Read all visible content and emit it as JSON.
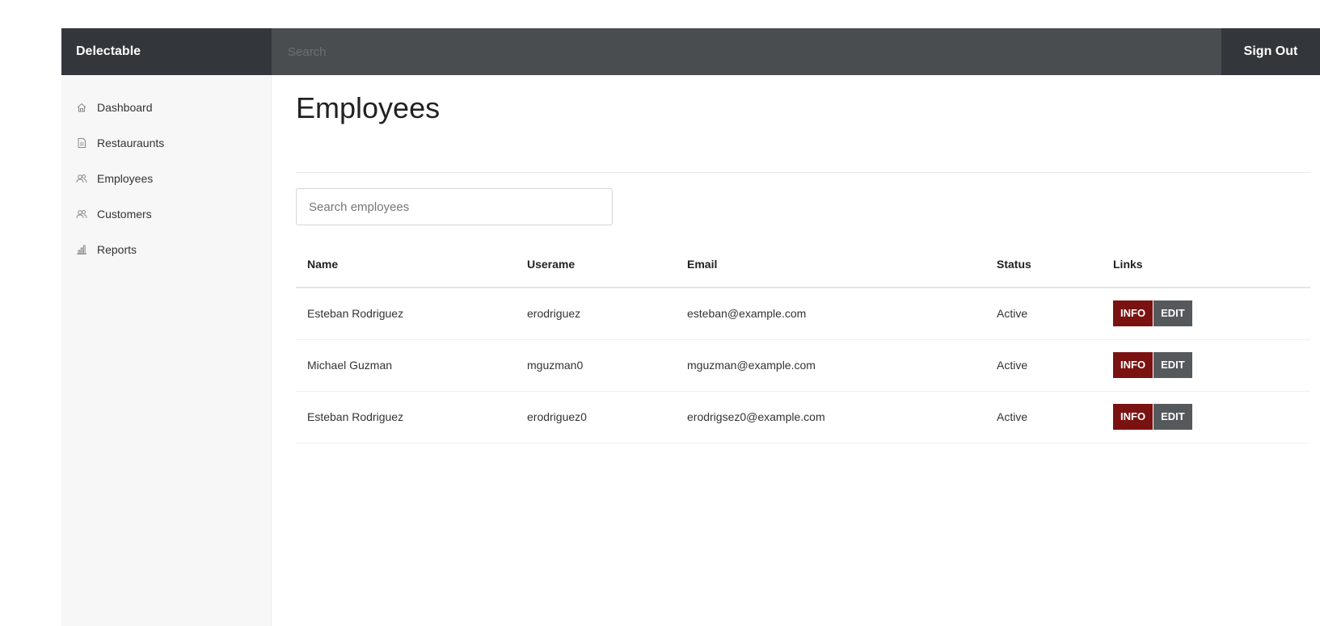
{
  "app": {
    "brand": "Delectable"
  },
  "topbar": {
    "search_placeholder": "Search",
    "signout_label": "Sign Out"
  },
  "sidebar": {
    "items": [
      {
        "label": "Dashboard",
        "icon": "home-icon"
      },
      {
        "label": "Restauraunts",
        "icon": "document-icon"
      },
      {
        "label": "Employees",
        "icon": "users-icon"
      },
      {
        "label": "Customers",
        "icon": "users-icon"
      },
      {
        "label": "Reports",
        "icon": "bar-chart-icon"
      }
    ]
  },
  "main": {
    "title": "Employees",
    "search_placeholder": "Search employees",
    "table": {
      "headers": {
        "name": "Name",
        "username": "Userame",
        "email": "Email",
        "status": "Status",
        "links": "Links"
      },
      "rows": [
        {
          "name": "Esteban Rodriguez",
          "username": "erodriguez",
          "email": "esteban@example.com",
          "status": "Active"
        },
        {
          "name": "Michael Guzman",
          "username": "mguzman0",
          "email": "mguzman@example.com",
          "status": "Active"
        },
        {
          "name": "Esteban Rodriguez",
          "username": "erodriguez0",
          "email": "erodrigsez0@example.com",
          "status": "Active"
        }
      ],
      "info_label": "INFO",
      "edit_label": "EDIT"
    }
  },
  "colors": {
    "topbar": "#4a4d50",
    "brand_bg": "#33373b",
    "info_button": "#7a1212",
    "edit_button": "#55595c",
    "active_status": "#4caf50"
  }
}
